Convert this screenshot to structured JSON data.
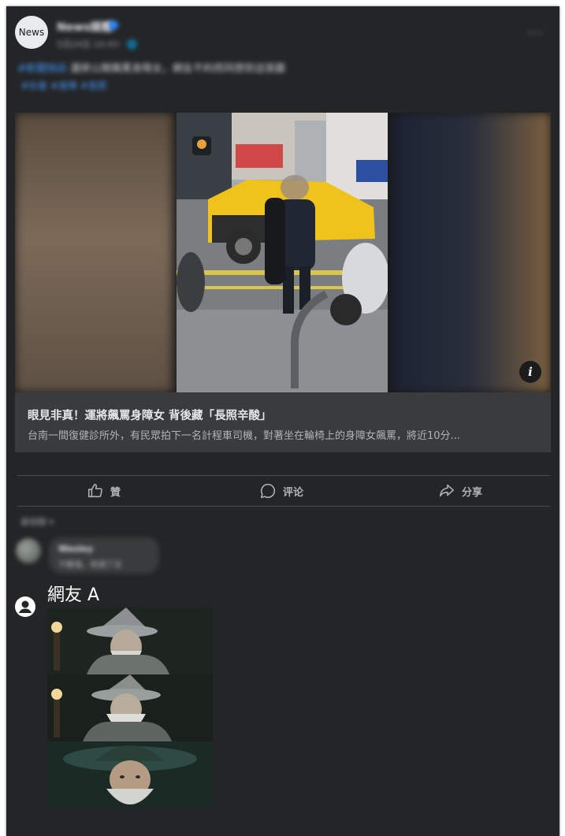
{
  "post": {
    "avatar_label": "News",
    "page_name": "News媒體",
    "meta": "5月24日 14:43 · 🌐",
    "text_highlight": "#新聞快訊",
    "text": " 運將公開飆罵身障女，網友不約而同想到這張圖",
    "tags": "#社會 #身障 #長照",
    "more_label": "···"
  },
  "media": {
    "info_label": "i"
  },
  "link_preview": {
    "title": "眼見非真！運將飆罵身障女 背後藏「長照辛酸」",
    "description": "台南一間復健診所外，有民眾拍下一名計程車司機，對著坐在輪椅上的身障女飆罵，將近10分..."
  },
  "actions": {
    "like_label": "贊",
    "comment_label": "评论",
    "share_label": "分享"
  },
  "comments": {
    "sort_label": "最相關 ▾",
    "first": {
      "name": "Wesley",
      "text": "不難懂，想通了沒"
    },
    "second": {
      "name": "網友 A"
    }
  },
  "colors": {
    "card_bg": "#242526",
    "link_bg": "#3a3b3c",
    "accent": "#2d88ff"
  }
}
